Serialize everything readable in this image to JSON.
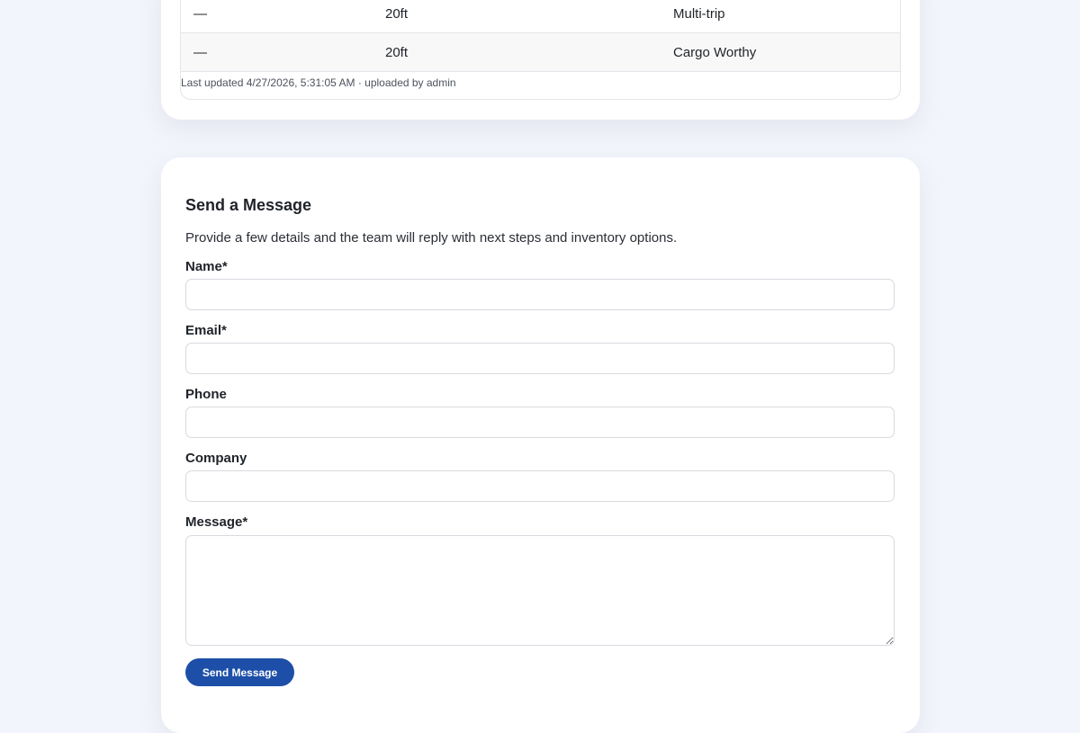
{
  "inventory_table": {
    "rows": [
      {
        "col1": "—",
        "col2": "20ft",
        "col3": "Multi-trip"
      },
      {
        "col1": "—",
        "col2": "20ft",
        "col3": "Cargo Worthy"
      }
    ],
    "updated_note": "Last updated 4/27/2026, 5:31:05 AM · uploaded by admin"
  },
  "contact_form": {
    "title": "Send a Message",
    "description": "Provide a few details and the team will reply with next steps and inventory options.",
    "fields": {
      "name": {
        "label": "Name*",
        "value": ""
      },
      "email": {
        "label": "Email*",
        "value": ""
      },
      "phone": {
        "label": "Phone",
        "value": ""
      },
      "company": {
        "label": "Company",
        "value": ""
      },
      "message": {
        "label": "Message*",
        "value": ""
      }
    },
    "submit_label": "Send Message"
  },
  "colors": {
    "page_background": "#f3f5fc",
    "card_background": "#ffffff",
    "button_primary": "#1d4fa8",
    "row_alt_background": "#f8f8f8"
  }
}
